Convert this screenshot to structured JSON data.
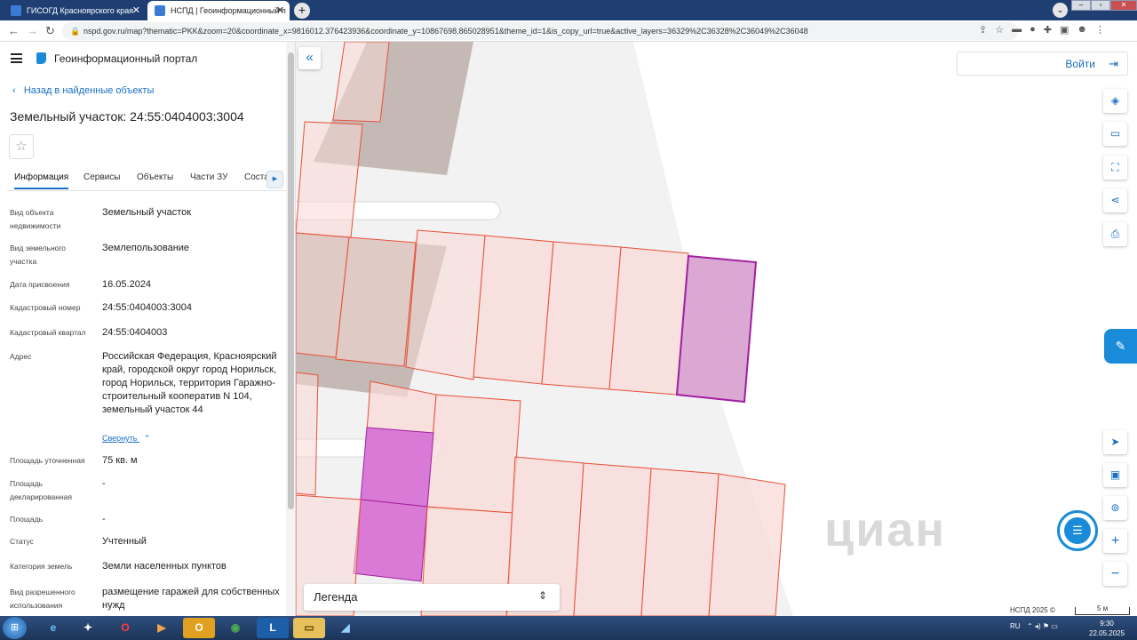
{
  "browser": {
    "tabs": [
      {
        "title": "ГИСОГД Красноярского края"
      },
      {
        "title": "НСПД | Геоинформационный п"
      }
    ],
    "url": "nspd.gov.ru/map?thematic=PKK&zoom=20&coordinate_x=9816012.376423936&coordinate_y=10867698.865028951&theme_id=1&is_copy_url=true&active_layers=36329%2C36328%2C36049%2C36048"
  },
  "header": {
    "portal_title": "Геоинформационный портал"
  },
  "nav": {
    "back_label": "Назад в найденные объекты"
  },
  "object": {
    "title": "Земельный участок: 24:55:0404003:3004",
    "tabs": [
      "Информация",
      "Сервисы",
      "Объекты",
      "Части ЗУ",
      "Соста"
    ],
    "properties": [
      {
        "key": "Вид объекта недвижимости",
        "value": "Земельный участок"
      },
      {
        "key": "Вид земельного участка",
        "value": "Землепользование"
      },
      {
        "key": "Дата присвоения",
        "value": "16.05.2024"
      },
      {
        "key": "Кадастровый номер",
        "value": "24:55:0404003:3004"
      },
      {
        "key": "Кадастровый квартал",
        "value": "24:55:0404003"
      },
      {
        "key": "Адрес",
        "value": "Российская Федерация, Красноярский край, городской округ город Норильск, город Норильск, территория Гаражно-строительный кооператив N 104, земельный участок 44"
      },
      {
        "key": "Площадь уточненная",
        "value": "75 кв. м"
      },
      {
        "key": "Площадь декларированная",
        "value": "-"
      },
      {
        "key": "Площадь",
        "value": "-"
      },
      {
        "key": "Статус",
        "value": "Учтенный"
      },
      {
        "key": "Категория земель",
        "value": "Земли населенных пунктов"
      },
      {
        "key": "Вид разрешенного использования",
        "value": "размещение гаражей для собственных нужд"
      }
    ],
    "collapse_label": "Свернуть"
  },
  "map": {
    "login_label": "Войти",
    "legend_label": "Легенда",
    "watermark": "циан",
    "copyright": "НСПД 2025 ©",
    "scale_label": "5 м",
    "colors": {
      "parcel_fill": "#f8d9d6",
      "parcel_stroke": "#e8503a",
      "selected_fill": "#dba8d4",
      "selected_stroke": "#a01fa0",
      "highlight_fill": "#d97bd6",
      "building": "#c4b9b4"
    }
  },
  "taskbar": {
    "lang": "RU",
    "time": "9:30",
    "date": "22.05.2025"
  }
}
